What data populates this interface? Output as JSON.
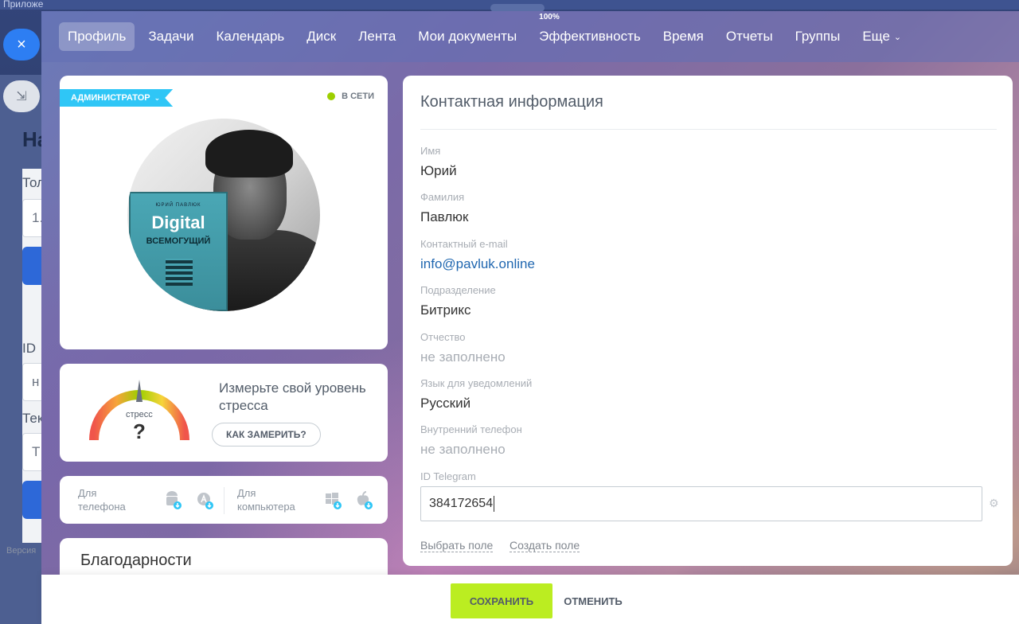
{
  "background": {
    "hint_text": "Приложе",
    "heading_fragment": "На",
    "fragments": [
      "Тол",
      "1.",
      "ID",
      "н",
      "Тек",
      "Т",
      "Версия"
    ]
  },
  "controls": {
    "close_icon": "×",
    "collapse_icon": "⇲"
  },
  "nav": {
    "items": [
      {
        "label": "Профиль",
        "active": true
      },
      {
        "label": "Задачи"
      },
      {
        "label": "Календарь"
      },
      {
        "label": "Диск"
      },
      {
        "label": "Лента"
      },
      {
        "label": "Мои документы"
      },
      {
        "label": "Эффективность",
        "badge": "100%"
      },
      {
        "label": "Время"
      },
      {
        "label": "Отчеты"
      },
      {
        "label": "Группы"
      },
      {
        "label": "Еще"
      }
    ]
  },
  "profile": {
    "role": "АДМИНИСТРАТОР",
    "status": "В СЕТИ",
    "status_color": "#9dcf00",
    "book": {
      "author": "ЮРИЙ ПАВЛЮК",
      "title": "Digital",
      "subtitle": "ВСЕМОГУЩИЙ"
    }
  },
  "stress": {
    "gauge_label": "стресс",
    "gauge_value": "?",
    "text": "Измерьте свой уровень стресса",
    "button": "КАК ЗАМЕРИТЬ?"
  },
  "apps": {
    "phone_label_line1": "Для",
    "phone_label_line2": "телефона",
    "computer_label_line1": "Для",
    "computer_label_line2": "компьютера",
    "icons": [
      "android-icon",
      "appstore-icon",
      "windows-icon",
      "apple-icon"
    ]
  },
  "thanks": {
    "title": "Благодарности"
  },
  "contact": {
    "title": "Контактная информация",
    "fields": [
      {
        "label": "Имя",
        "value": "Юрий"
      },
      {
        "label": "Фамилия",
        "value": "Павлюк"
      },
      {
        "label": "Контактный e-mail",
        "value": "info@pavluk.online"
      },
      {
        "label": "Подразделение",
        "value": "Битрикс"
      },
      {
        "label": "Отчество",
        "value": "не заполнено"
      },
      {
        "label": "Язык для уведомлений",
        "value": "Русский"
      },
      {
        "label": "Внутренний телефон",
        "value": "не заполнено"
      },
      {
        "label": "ID Telegram",
        "value": "384172654"
      }
    ],
    "select_field": "Выбрать поле",
    "create_field": "Создать поле"
  },
  "footer": {
    "save": "СОХРАНИТЬ",
    "cancel": "ОТМЕНИТЬ",
    "save_color": "#bbed21"
  }
}
